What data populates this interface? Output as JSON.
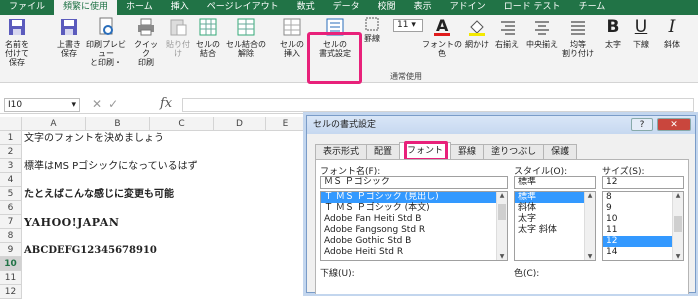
{
  "tabs": [
    "ファイル",
    "頻繁に使用",
    "ホーム",
    "挿入",
    "ページレイアウト",
    "数式",
    "データ",
    "校閲",
    "表示",
    "アドイン",
    "ロード テスト",
    "チーム"
  ],
  "ribbon": {
    "buttons": [
      {
        "l1": "名前を付けて",
        "l2": "保存"
      },
      {
        "l1": "上書き",
        "l2": "保存"
      },
      {
        "l1": "印刷プレビュー",
        "l2": "と印刷・"
      },
      {
        "l1": "クイック",
        "l2": "印刷"
      },
      {
        "l1": "貼り付け",
        "l2": ""
      },
      {
        "l1": "セルの",
        "l2": "結合"
      },
      {
        "l1": "セル結合の",
        "l2": "解除"
      },
      {
        "l1": "セルの",
        "l2": "挿入"
      },
      {
        "l1": "セルの",
        "l2": "書式設定"
      },
      {
        "l1": "罫線",
        "l2": ""
      }
    ],
    "font_size": "11",
    "buttons2": [
      {
        "l1": "フォントの色",
        "l2": ""
      },
      {
        "l1": "網かけ",
        "l2": ""
      },
      {
        "l1": "右揃え",
        "l2": ""
      },
      {
        "l1": "中央揃え",
        "l2": ""
      },
      {
        "l1": "均等",
        "l2": "割り付け"
      },
      {
        "l1": "太字",
        "l2": ""
      },
      {
        "l1": "下線",
        "l2": ""
      },
      {
        "l1": "斜体",
        "l2": ""
      }
    ],
    "group_label": "通常使用"
  },
  "formula": {
    "namebox": "I10",
    "fx": "fx",
    "input": ""
  },
  "columns": [
    "A",
    "B",
    "C",
    "D",
    "E"
  ],
  "rows": [
    "1",
    "2",
    "3",
    "4",
    "5",
    "6",
    "7",
    "8",
    "9",
    "10",
    "11",
    "12"
  ],
  "cells": {
    "r1": "文字のフォントを決めましょう",
    "r3": "標準はMS Pゴシックになっているはず",
    "r5": "たとえばこんな感じに変更も可能",
    "r7": "YAHOO!JAPAN",
    "r9": "ABCDEFG12345678910"
  },
  "dialog": {
    "title": "セルの書式設定",
    "help": "?",
    "close": "✕",
    "tabs": [
      "表示形式",
      "配置",
      "フォント",
      "罫線",
      "塗りつぶし",
      "保護"
    ],
    "font_name_label": "フォント名(F):",
    "font_name_value": "ＭＳ Ｐゴシック",
    "font_list": [
      "Ｔ ＭＳ Ｐゴシック (見出し)",
      "Ｔ ＭＳ Ｐゴシック (本文)",
      "Adobe Fan Heiti Std B",
      "Adobe Fangsong Std R",
      "Adobe Gothic Std B",
      "Adobe Heiti Std R"
    ],
    "style_label": "スタイル(O):",
    "style_value": "標準",
    "style_list": [
      "標準",
      "斜体",
      "太字",
      "太字 斜体"
    ],
    "size_label": "サイズ(S):",
    "size_value": "12",
    "size_list": [
      "8",
      "9",
      "10",
      "11",
      "12",
      "14"
    ],
    "underline_label": "下線(U):",
    "color_label": "色(C):"
  }
}
